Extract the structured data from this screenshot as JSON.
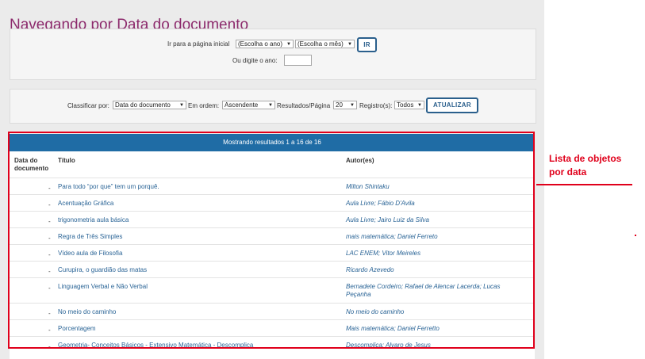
{
  "title": "Navegando por Data do documento",
  "jump": {
    "label": "Ir para a página inicial",
    "year_select": "(Escolha o ano)",
    "month_select": "(Escolha o mês)",
    "go_button": "IR",
    "type_year_label": "Ou digite o ano:",
    "year_input_value": ""
  },
  "sort": {
    "sort_by_label": "Classificar por:",
    "sort_by_value": "Data do documento",
    "order_label": "Em ordem:",
    "order_value": "Ascendente",
    "rpp_label": "Resultados/Página",
    "rpp_value": "20",
    "records_label": "Registro(s):",
    "records_value": "Todos",
    "update_button": "ATUALIZAR"
  },
  "results": {
    "summary": "Mostrando resultados 1 a 16 de 16",
    "headers": {
      "date": "Data do documento",
      "title": "Título",
      "authors": "Autor(es)"
    },
    "rows": [
      {
        "date": "-",
        "title": "Para todo “por que” tem um porquê.",
        "authors": "Milton Shintaku"
      },
      {
        "date": "-",
        "title": "Acentuação Gráfica",
        "authors": "Aula Livre; Fábio D'Avila"
      },
      {
        "date": "-",
        "title": "trigonometria aula básica",
        "authors": "Aula Livre; Jairo Luiz da Silva"
      },
      {
        "date": "-",
        "title": "Regra de Três Simples",
        "authors": "mais matemática; Daniel Ferreto"
      },
      {
        "date": "-",
        "title": "Vídeo aula de Filosofia",
        "authors": "LAC ENEM; Vitor Meireles"
      },
      {
        "date": "-",
        "title": "Curupira, o guardião das matas",
        "authors": "Ricardo Azevedo"
      },
      {
        "date": "-",
        "title": "Linguagem Verbal e Não Verbal",
        "authors": "Bernadete Cordeiro; Rafael de Alencar Lacerda; Lucas Peçanha"
      },
      {
        "date": "-",
        "title": "No meio do caminho",
        "authors": "No meio do caminho"
      },
      {
        "date": "-",
        "title": "Porcentagem",
        "authors": "Mais matemática; Daniel Ferretto"
      },
      {
        "date": "-",
        "title": "Geometria- Conceitos Básicos - Extensivo Matemática - Descomplica",
        "authors": "Descomplica; Alvaro de Jesus"
      }
    ]
  },
  "annotation": {
    "line1": "Lista de objetos",
    "line2": "por data",
    "color": "#e0001b"
  },
  "colors": {
    "title": "#8c2a6c",
    "header_bar": "#1f6ca5",
    "link": "#2a6496"
  },
  "icons": {
    "select_arrow": "chevron-down-icon"
  }
}
